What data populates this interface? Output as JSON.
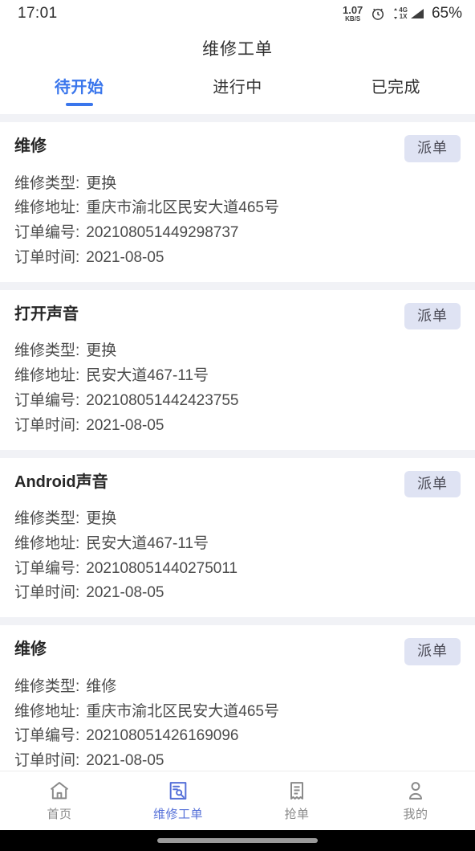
{
  "status_bar": {
    "time": "17:01",
    "net_speed_value": "1.07",
    "net_speed_unit": "KB/S",
    "alarm_icon": "alarm-clock-icon",
    "network_top": "4G",
    "network_bottom": "1X",
    "signal_icon": "signal-bars-icon",
    "battery": "65%"
  },
  "header": {
    "title": "维修工单"
  },
  "tabs": [
    {
      "label": "待开始",
      "active": true
    },
    {
      "label": "进行中",
      "active": false
    },
    {
      "label": "已完成",
      "active": false
    }
  ],
  "labels": {
    "repair_type": "维修类型:",
    "repair_address": "维修地址:",
    "order_number": "订单编号:",
    "order_time": "订单时间:",
    "dispatch": "派单"
  },
  "orders": [
    {
      "title": "维修",
      "repair_type": "更换",
      "repair_address": "重庆市渝北区民安大道465号",
      "order_number": "202108051449298737",
      "order_time": "2021-08-05",
      "action": "派单"
    },
    {
      "title": "打开声音",
      "repair_type": "更换",
      "repair_address": "民安大道467-11号",
      "order_number": "202108051442423755",
      "order_time": "2021-08-05",
      "action": "派单"
    },
    {
      "title": "Android声音",
      "repair_type": "更换",
      "repair_address": "民安大道467-11号",
      "order_number": "202108051440275011",
      "order_time": "2021-08-05",
      "action": "派单"
    },
    {
      "title": "维修",
      "repair_type": "维修",
      "repair_address": "重庆市渝北区民安大道465号",
      "order_number": "202108051426169096",
      "order_time": "2021-08-05",
      "action": "派单"
    }
  ],
  "bottom_nav": [
    {
      "label": "首页",
      "icon": "home-icon",
      "active": false
    },
    {
      "label": "维修工单",
      "icon": "work-order-wrench-icon",
      "active": true
    },
    {
      "label": "抢单",
      "icon": "receipt-icon",
      "active": false
    },
    {
      "label": "我的",
      "icon": "person-icon",
      "active": false
    }
  ],
  "colors": {
    "accent": "#3a76ec",
    "nav_active": "#5570d8",
    "button_bg": "#dfe3f3",
    "page_bg": "#f1f2f6"
  }
}
